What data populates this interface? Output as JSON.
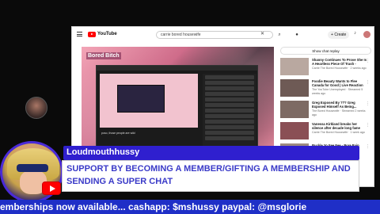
{
  "youtube": {
    "brand": "YouTube",
    "search_query": "carrie bored housewife",
    "create_label": "Create",
    "show_chat_replay": "Show chat replay",
    "video_banner": "Bored Bitch",
    "inner_caption": "poso, those people are wild"
  },
  "recommendations": [
    {
      "title": "Shanny Continues To Prove She Is A Heartless Piece Of Trash -",
      "meta": "Carrie The Bored Housewife · 2 weeks ago"
    },
    {
      "title": "Foodie Beauty Wants to Flee Canada for Good | Live Reaction",
      "meta": "The YouTube Unemployed · Streamed 5 weeks ago"
    },
    {
      "title": "Greg Exposed By ??? Greg Exposed Himself As Being...",
      "meta": "The Bored Housewife · Streamed 2 weeks ago"
    },
    {
      "title": "Vanessa Kirkland breaks her silence after decade long fame",
      "meta": "Carrie The Bored Housewife · 1 week ago"
    },
    {
      "title": "Buckle Yo Fee Fee - Pore Pain",
      "meta": ""
    }
  ],
  "overlay": {
    "username": "Loudmouthhussy",
    "message": "SUPPORT BY BECOMING A MEMBER/GIFTING A MEMBERSHIP AND SENDING A SUPER CHAT",
    "ticker": "emberships now available... cashapp: $mshussy paypal: @msglorie"
  }
}
